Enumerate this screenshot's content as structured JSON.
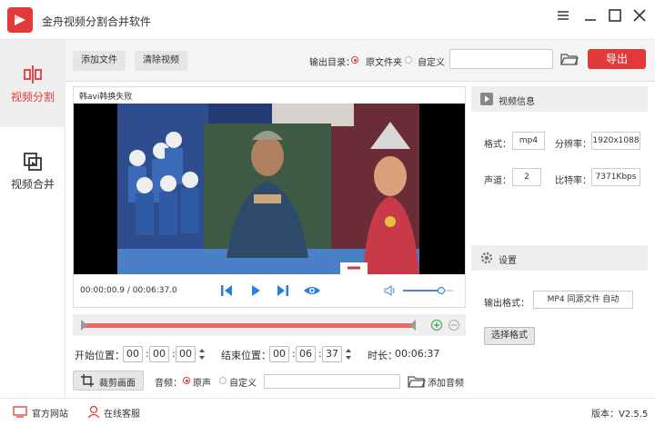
{
  "window": {
    "title": "金舟视频分割合并软件"
  },
  "sidebar": {
    "items": [
      {
        "label": "视频分割",
        "icon": "split-icon"
      },
      {
        "label": "视频合并",
        "icon": "merge-icon"
      }
    ]
  },
  "toolbar": {
    "add_file": "添加文件",
    "clear_video": "清除视频",
    "output_dir_label": "输出目录：",
    "option_source": "原文件夹",
    "option_custom": "自定义",
    "output_path": "",
    "export": "导出"
  },
  "video": {
    "title": "韩avi韩换失败",
    "timecode": "00:00:00.9 / 00:06:37.0",
    "volume": 0.75
  },
  "trim": {
    "start_label": "开始位置：",
    "start": [
      "00",
      "00",
      "00"
    ],
    "end_label": "结束位置：",
    "end": [
      "00",
      "06",
      "37"
    ],
    "duration_label": "时长：",
    "duration": "00:06:37"
  },
  "bottom": {
    "crop": "裁剪画面",
    "audio_label": "音频：",
    "audio_source": "原声",
    "audio_custom": "自定义",
    "audio_path": "",
    "add_audio": "添加音频"
  },
  "info": {
    "header": "视频信息",
    "format_label": "格式：",
    "format": "mp4",
    "resolution_label": "分辨率：",
    "resolution": "1920x1088",
    "channels_label": "声道：",
    "channels": "2",
    "bitrate_label": "比特率：",
    "bitrate": "7371Kbps"
  },
  "settings": {
    "header": "设置",
    "output_format_label": "输出格式：",
    "output_format": "MP4 同源文件 自动",
    "choose_format": "选择格式"
  },
  "footer": {
    "website": "官方网站",
    "support": "在线客服",
    "version": "版本：V2.5.5"
  },
  "colors": {
    "accent": "#e03a3a",
    "timeline": "#e8675e",
    "play": "#2b7de0"
  }
}
